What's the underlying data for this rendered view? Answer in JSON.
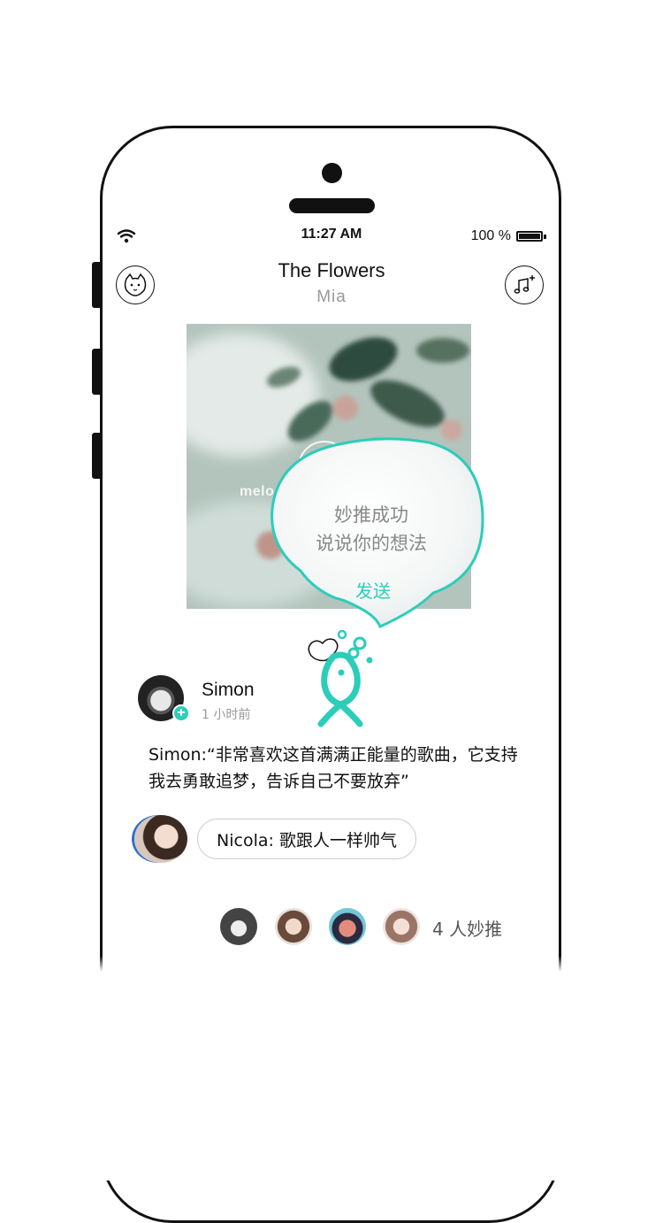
{
  "status_bar": {
    "time": "11:27 AM",
    "battery_text": "100 %"
  },
  "header": {
    "left_icon": "cat-face-icon",
    "right_icon": "music-note-plus-icon",
    "song_title": "The Flowers",
    "artist": "Mia"
  },
  "cover": {
    "overlay_text": "melod"
  },
  "bubble": {
    "line1": "妙推成功",
    "line2": "说说你的想法",
    "send_label": "发送"
  },
  "post": {
    "username": "Simon",
    "time_ago": "1 小时前",
    "text": "Simon:“非常喜欢这首满满正能量的歌曲，它支持我去勇敢追梦，告诉自己不要放弃”",
    "follow_badge": "+"
  },
  "comment": {
    "text": "Nicola: 歌跟人一样帅气"
  },
  "likes": {
    "summary": "4 人妙推"
  },
  "colors": {
    "accent": "#2ccdb9",
    "text": "#111111",
    "muted": "#999999"
  }
}
